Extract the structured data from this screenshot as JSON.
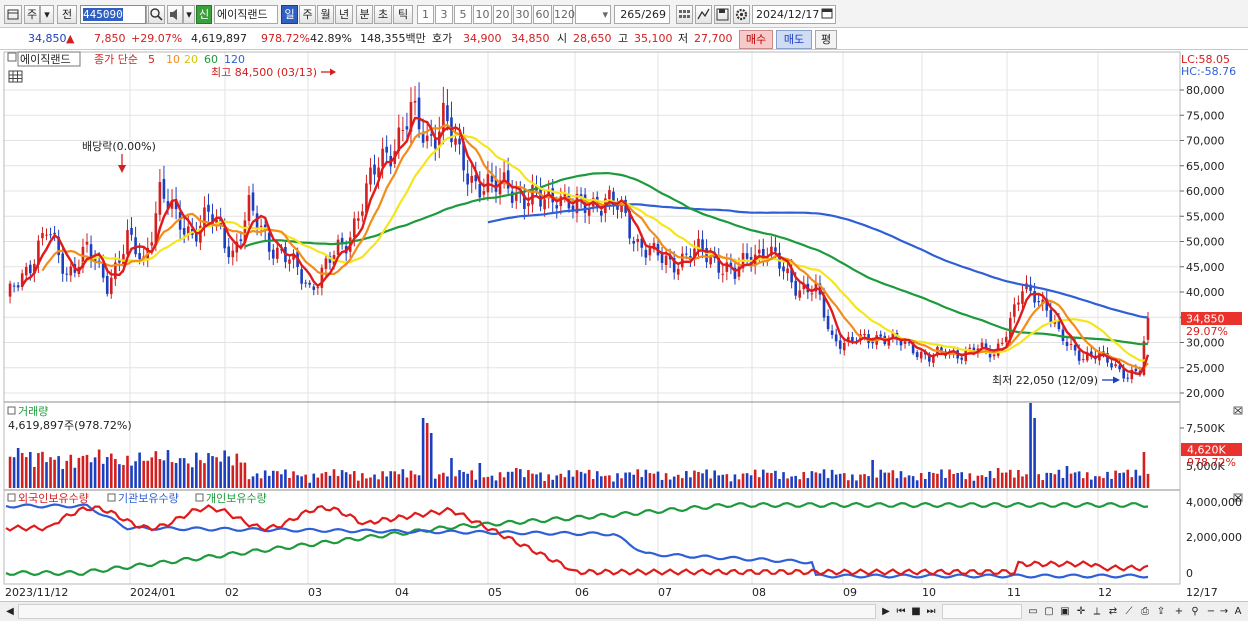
{
  "toolbar": {
    "type_label": "주",
    "period_label": "전",
    "code": "445090",
    "badge": "신",
    "name": "에이직랜드",
    "intervals": [
      "일",
      "주",
      "월",
      "년",
      "분",
      "초",
      "틱"
    ],
    "active_interval": "일",
    "minutes": [
      "1",
      "3",
      "5",
      "10",
      "20",
      "30",
      "60",
      "120"
    ],
    "count": "265",
    "total": "/269",
    "date": "2024/12/17"
  },
  "quote": {
    "price": "34,850",
    "change": "7,850",
    "change_pct": "+29.07%",
    "volume": "4,619,897",
    "volume_ratio": "978.72%",
    "turnover": "42.89%",
    "amount": "148,355백만",
    "bid_label": "호가",
    "ask": "34,900",
    "bid": "34,850",
    "open_label": "시",
    "open": "28,650",
    "high_label": "고",
    "high": "35,100",
    "low_label": "저",
    "low": "27,700",
    "buy_label": "매수",
    "sell_label": "매도",
    "eval_label": "평"
  },
  "price_pane": {
    "name_box": "에이직랜드",
    "legend_prefix": "종가 단순",
    "ma_periods": [
      "5",
      "10",
      "20",
      "60",
      "120"
    ],
    "lc_label": "LC:58.05",
    "hc_label": "HC:-58.76",
    "high_marker": "최고 84,500 (03/13)",
    "low_marker": "최저 22,050 (12/09)",
    "dividend_marker": "배당락(0.00%)",
    "price_tag": "34,850",
    "pct_tag": "29.07%",
    "y_ticks": [
      "80,000",
      "75,000",
      "70,000",
      "65,000",
      "60,000",
      "55,000",
      "50,000",
      "45,000",
      "40,000",
      "35,000",
      "30,000",
      "25,000",
      "20,000"
    ]
  },
  "volume_pane": {
    "title": "거래량",
    "value": "4,619,897주(978.72%)",
    "y_ticks": [
      "7,500K",
      "5,000K"
    ],
    "volume_tag": "4,620K",
    "pct_tag": "978.72%"
  },
  "holdings_pane": {
    "legend": [
      "외국인보유수량",
      "기관보유수량",
      "개인보유수량"
    ],
    "y_ticks": [
      "4,000,000",
      "2,000,000",
      "0"
    ]
  },
  "x_axis": {
    "labels": [
      "2023/11/12",
      "2024/01",
      "02",
      "03",
      "04",
      "05",
      "06",
      "07",
      "08",
      "09",
      "10",
      "11",
      "12",
      "12/17"
    ]
  },
  "colors": {
    "up": "#d21f1f",
    "down": "#1c3fbf",
    "ma5": "#e01b1b",
    "ma10": "#f28c1a",
    "ma20": "#f5e61c",
    "ma60": "#1e9a3c",
    "ma120": "#2f5fd6"
  }
}
